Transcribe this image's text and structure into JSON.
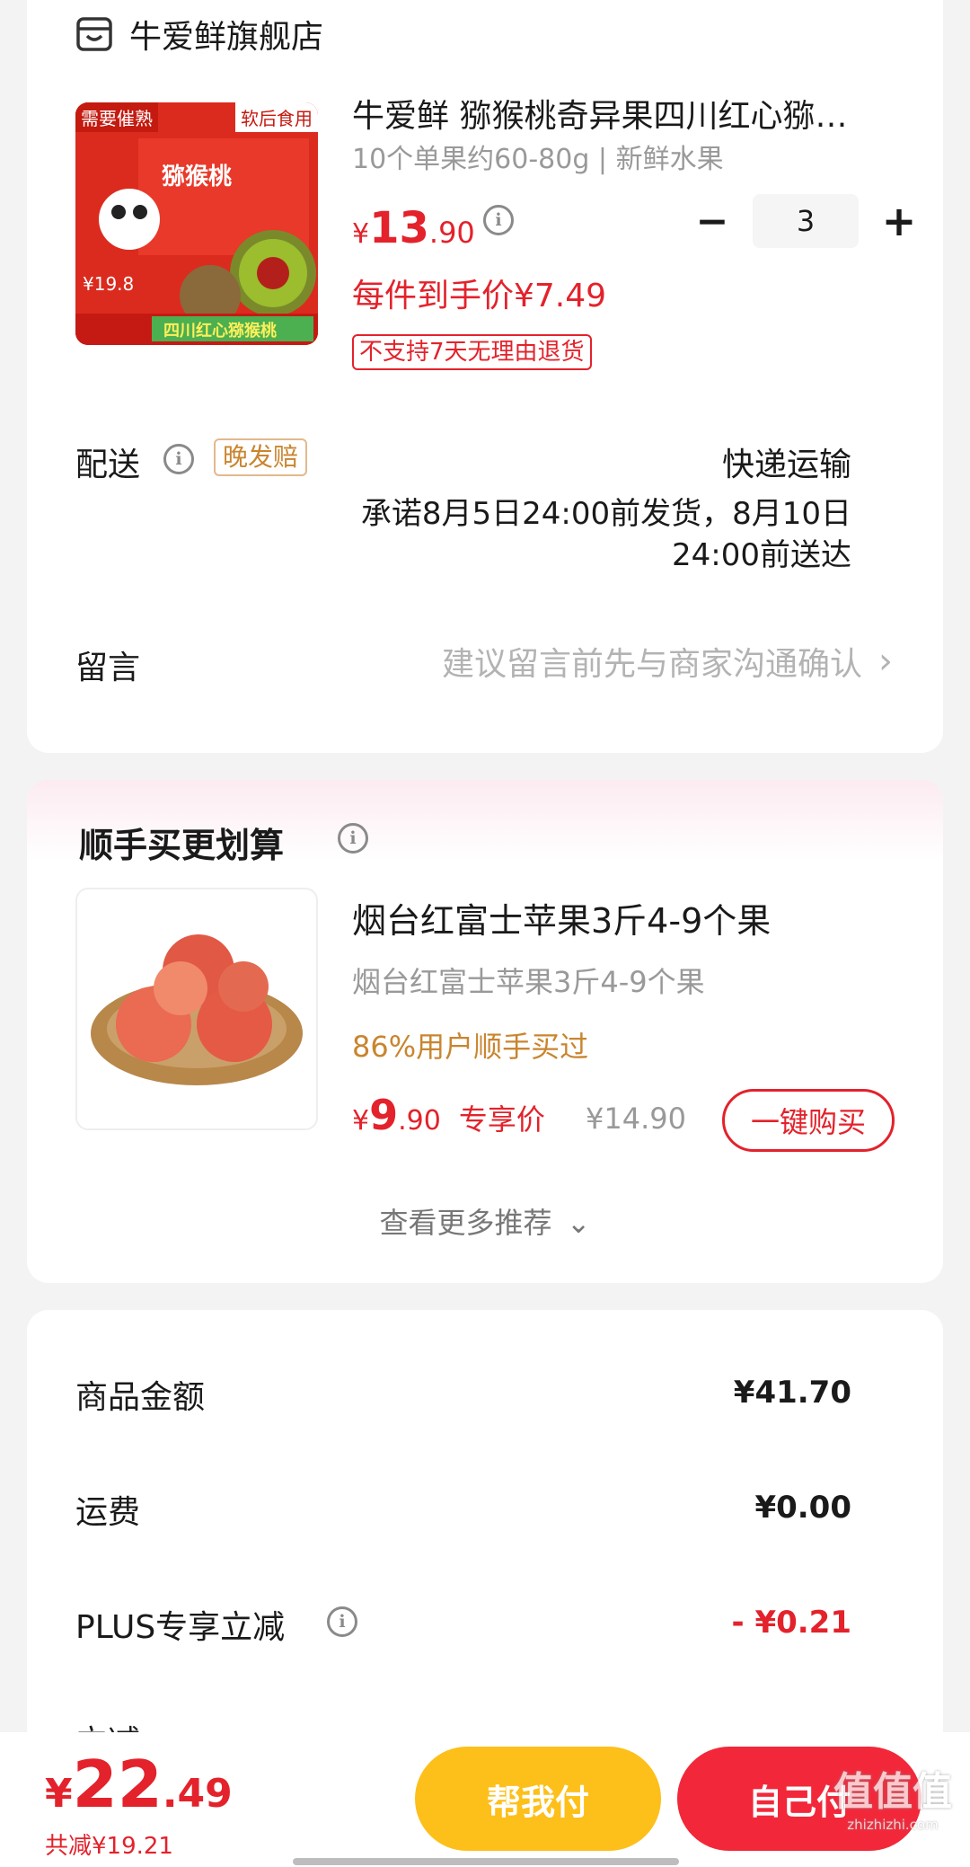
{
  "store": {
    "name": "牛爱鲜旗舰店",
    "icon": "store-icon"
  },
  "product": {
    "image_labels": {
      "tl": "需要催熟",
      "tr": "软后食用",
      "title": "猕猴桃",
      "price": "¥19.8",
      "bottom": "四川红心猕猴桃"
    },
    "title": "牛爱鲜 猕猴桃奇异果四川红心猕…",
    "spec": "10个单果约60-80g | 新鲜水果",
    "price_symbol": "¥",
    "price_int": "13",
    "price_dec": ".90",
    "unit_price": "每件到手价¥7.49",
    "return_tag": "不支持7天无理由退货",
    "qty": "3",
    "minus": "−",
    "plus": "+"
  },
  "delivery": {
    "label": "配送",
    "badge": "晚发赔",
    "method": "快递运输",
    "promise_line1": "承诺8月5日24:00前发货，8月10日",
    "promise_line2": "24:00前送达"
  },
  "message": {
    "label": "留言",
    "placeholder": "建议留言前先与商家沟通确认",
    "chevron": "›"
  },
  "recommend": {
    "title": "顺手买更划算",
    "item_title": "烟台红富士苹果3斤4-9个果",
    "item_sub": "烟台红富士苹果3斤4-9个果",
    "stat": "86%用户顺手买过",
    "price_symbol": "¥",
    "price_int": "9",
    "price_dec": ".90",
    "price_tag": "专享价",
    "orig_price": "¥14.90",
    "buy_button": "一键购买",
    "more": "查看更多推荐",
    "more_chevron": "⌄"
  },
  "summary": {
    "rows": [
      {
        "label": "商品金额",
        "value": "¥41.70"
      },
      {
        "label": "运费",
        "value": "¥0.00"
      },
      {
        "label": "PLUS专享立减",
        "value": "- ¥0.21"
      },
      {
        "label": "立减",
        "value": ""
      }
    ]
  },
  "bottom": {
    "total_symbol": "¥",
    "total_int": "22",
    "total_dec": ".49",
    "saved": "共减¥19.21",
    "help_pay": "帮我付",
    "self_pay": "自己付",
    "watermark": "值值值",
    "watermark_sub": "zhizhizhi.com"
  },
  "colors": {
    "accent_red": "#e3222b",
    "gold": "#fdbf1a",
    "badge_gold": "#c9852f"
  }
}
